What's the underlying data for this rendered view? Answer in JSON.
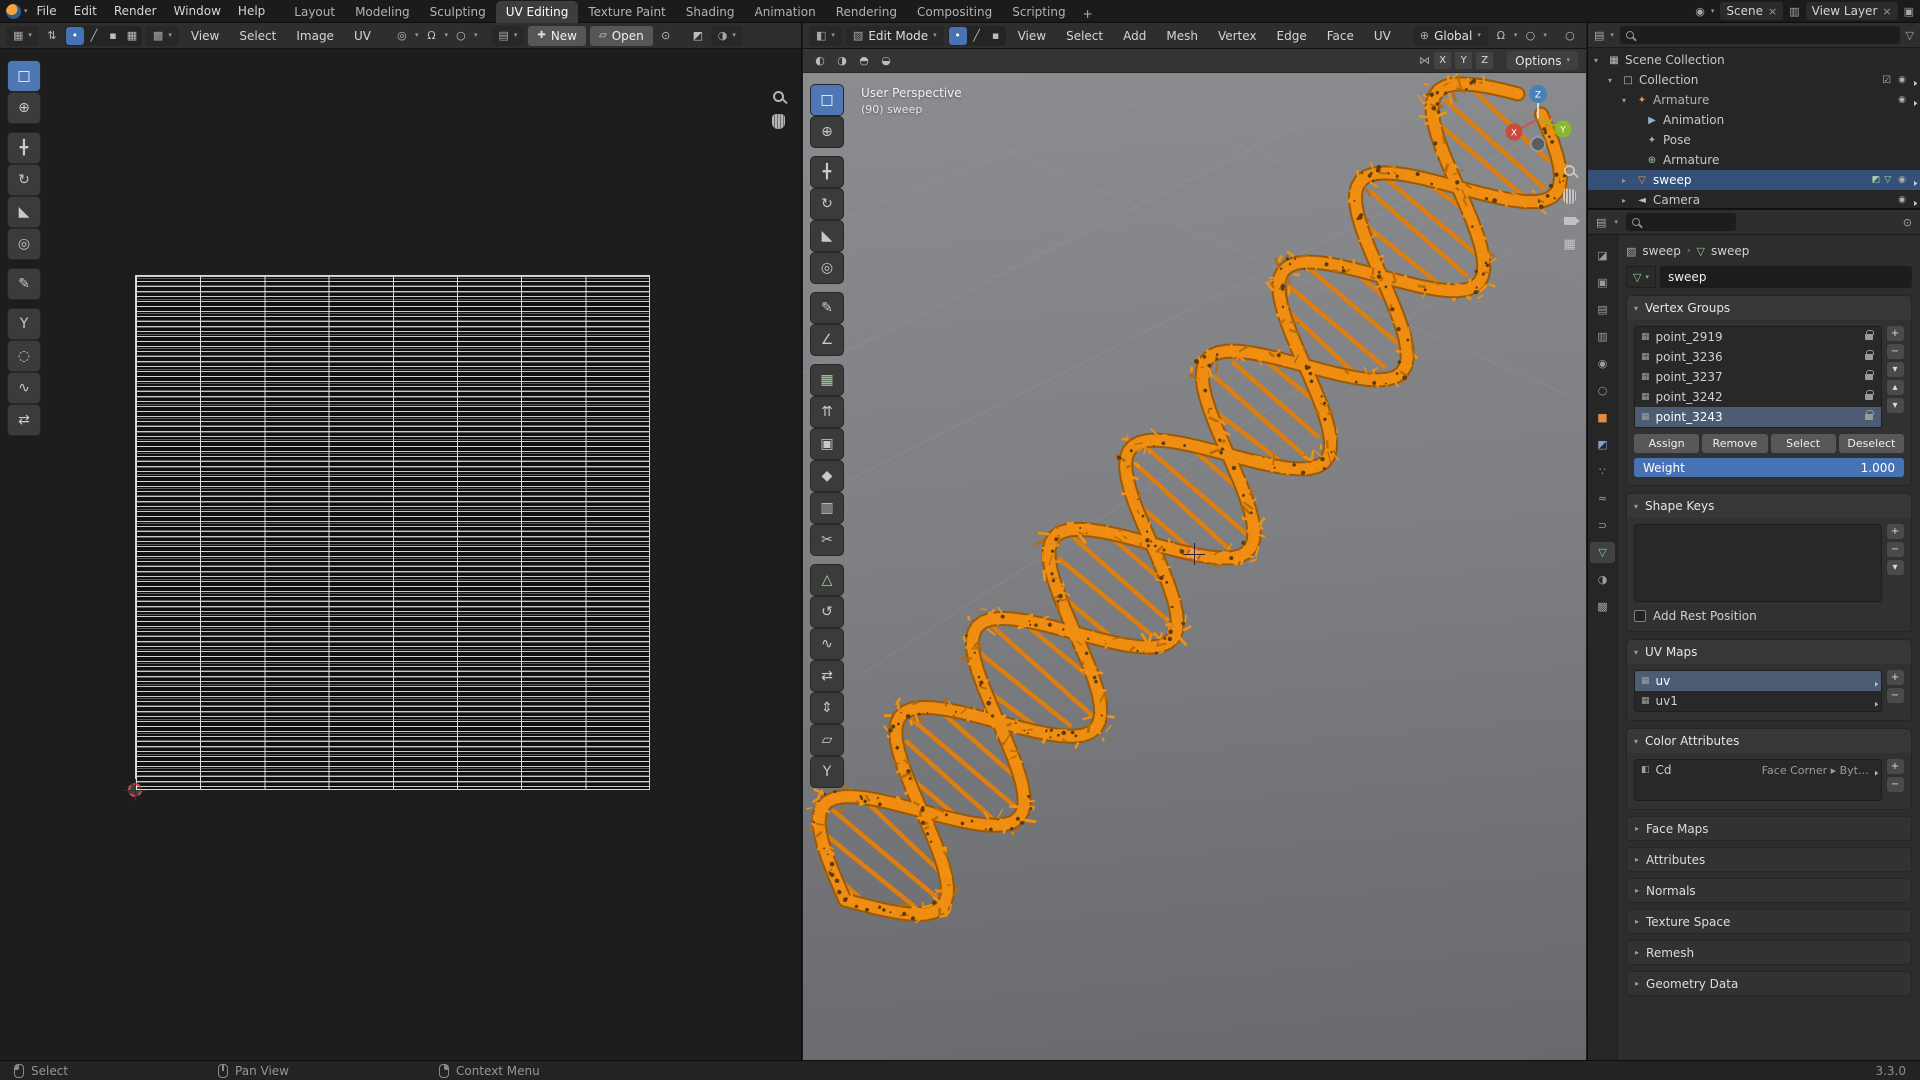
{
  "topbar": {
    "menus": [
      "File",
      "Edit",
      "Render",
      "Window",
      "Help"
    ],
    "workspaces": [
      "Layout",
      "Modeling",
      "Sculpting",
      "UV Editing",
      "Texture Paint",
      "Shading",
      "Animation",
      "Rendering",
      "Compositing",
      "Scripting"
    ],
    "active_workspace": "UV Editing",
    "add_tab": "+",
    "scene": {
      "label": "Scene"
    },
    "view_layer": {
      "label": "View Layer"
    }
  },
  "uv_editor": {
    "menus": [
      "View",
      "Select",
      "Image",
      "UV"
    ],
    "buttons": {
      "new": "New",
      "open": "Open"
    },
    "tools": [
      "select-box",
      "cursor",
      "move",
      "rotate",
      "scale",
      "transform",
      "annotate",
      "rip-region",
      "grab",
      "relax",
      "pinch"
    ]
  },
  "viewport": {
    "mode": "Edit Mode",
    "menus": [
      "View",
      "Select",
      "Add",
      "Mesh",
      "Vertex",
      "Edge",
      "Face",
      "UV"
    ],
    "orientation": "Global",
    "tool_settings": {
      "mirror_x": "X",
      "mirror_y": "Y",
      "mirror_z": "Z",
      "options": "Options"
    },
    "overlay": {
      "line1": "User Perspective",
      "line2": "(90) sweep"
    },
    "axis_gizmo": {
      "x": "X",
      "y": "Y",
      "z": "Z"
    },
    "tools": [
      "select-box",
      "cursor",
      "move",
      "rotate",
      "scale",
      "transform",
      "annotate",
      "measure",
      "add-cube",
      "extrude-region",
      "inset-faces",
      "bevel",
      "loop-cut",
      "knife",
      "poly-build",
      "spin",
      "smooth",
      "edge-slide",
      "shrink-fatten",
      "shear",
      "rip-region"
    ]
  },
  "outliner": {
    "rows": [
      {
        "label": "Scene Collection"
      },
      {
        "label": "Collection"
      },
      {
        "label": "Armature"
      },
      {
        "label": "Animation"
      },
      {
        "label": "Pose"
      },
      {
        "label": "Armature"
      },
      {
        "label": "sweep"
      },
      {
        "label": "Camera"
      }
    ]
  },
  "properties": {
    "breadcrumb": {
      "object": "sweep",
      "data": "sweep"
    },
    "name_field": "sweep",
    "vertex_groups": {
      "title": "Vertex Groups",
      "items": [
        {
          "name": "point_2919"
        },
        {
          "name": "point_3236"
        },
        {
          "name": "point_3237"
        },
        {
          "name": "point_3242"
        },
        {
          "name": "point_3243"
        }
      ],
      "buttons": {
        "assign": "Assign",
        "remove": "Remove",
        "select": "Select",
        "deselect": "Deselect"
      },
      "weight": {
        "label": "Weight",
        "value": "1.000"
      }
    },
    "shape_keys": {
      "title": "Shape Keys",
      "add_rest_position": "Add Rest Position"
    },
    "uv_maps": {
      "title": "UV Maps",
      "items": [
        {
          "name": "uv"
        },
        {
          "name": "uv1"
        }
      ]
    },
    "color_attributes": {
      "title": "Color Attributes",
      "items": [
        {
          "name": "Cd",
          "domain_type": "Face Corner ▸ Byt…"
        }
      ]
    },
    "collapsed_sections": [
      "Face Maps",
      "Attributes",
      "Normals",
      "Texture Space",
      "Remesh",
      "Geometry Data"
    ]
  },
  "statusbar": {
    "hints": [
      {
        "label": "Select"
      },
      {
        "label": "Pan View"
      },
      {
        "label": "Context Menu"
      }
    ],
    "version": "3.3.0"
  }
}
